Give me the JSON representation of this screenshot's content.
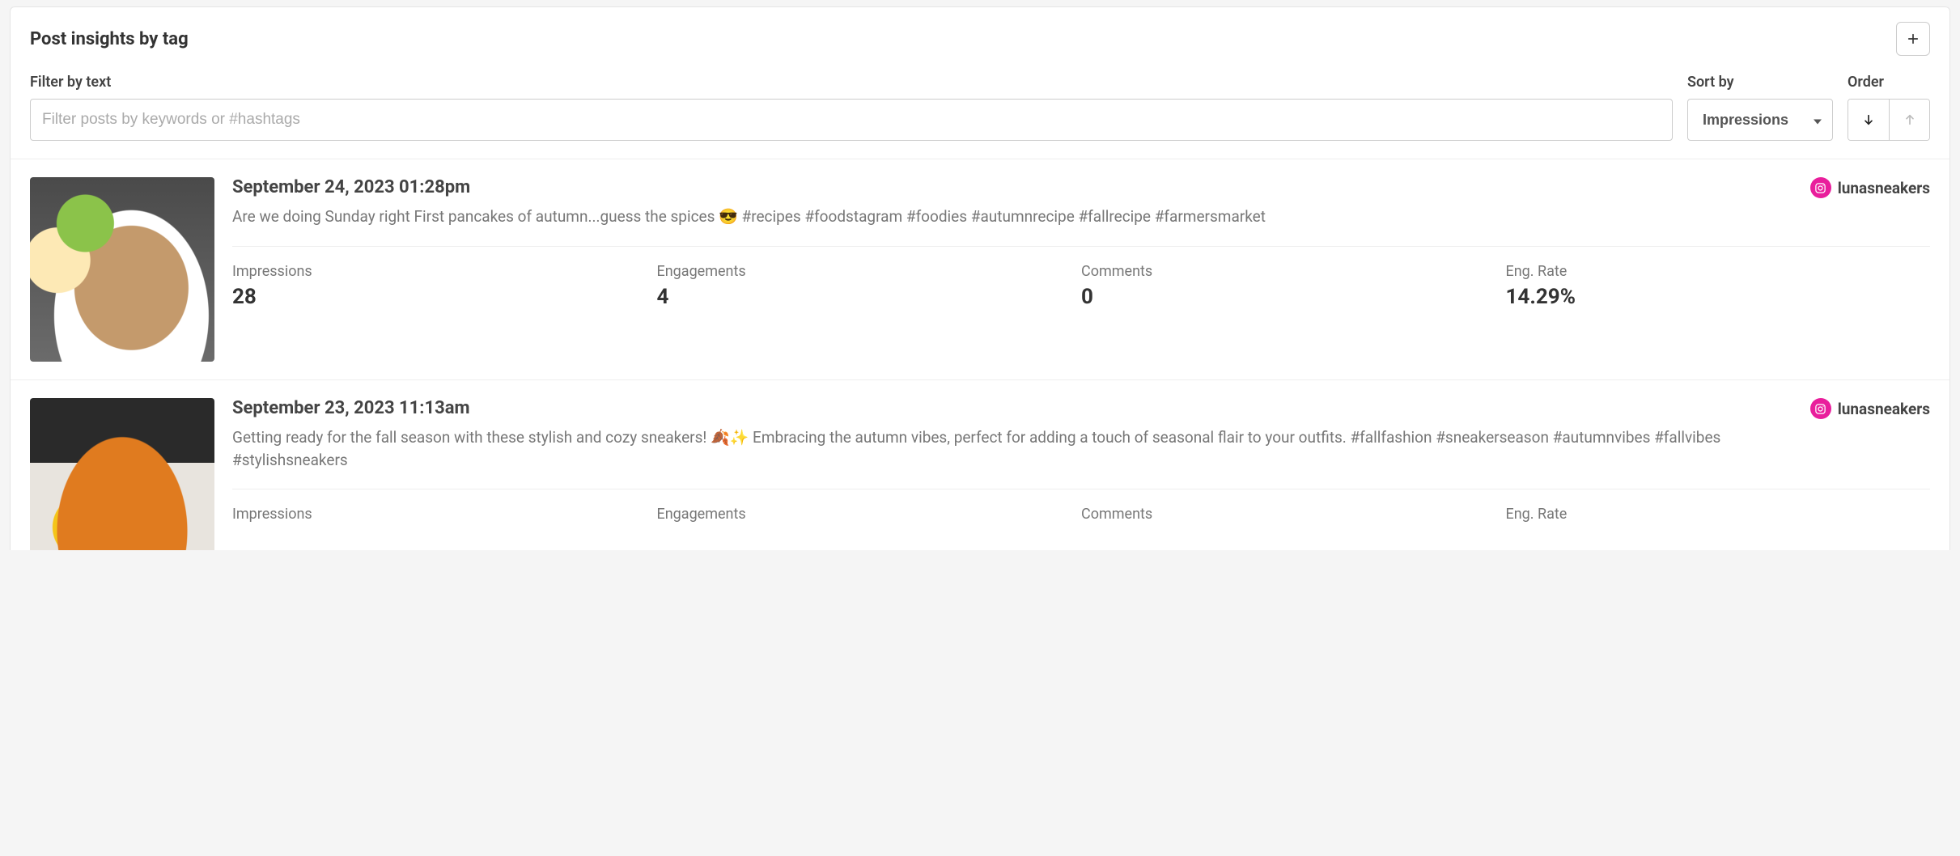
{
  "header": {
    "title": "Post insights by tag"
  },
  "controls": {
    "filter_label": "Filter by text",
    "filter_placeholder": "Filter posts by keywords or #hashtags",
    "sort_label": "Sort by",
    "sort_value": "Impressions",
    "order_label": "Order"
  },
  "metric_labels": {
    "impressions": "Impressions",
    "engagements": "Engagements",
    "comments": "Comments",
    "eng_rate": "Eng. Rate"
  },
  "posts": [
    {
      "date": "September 24, 2023 01:28pm",
      "caption": "Are we doing Sunday right First pancakes of autumn...guess the spices 😎 #recipes #foodstagram #foodies #autumnrecipe #fallrecipe #farmersmarket",
      "account": "lunasneakers",
      "metrics": {
        "impressions": "28",
        "engagements": "4",
        "comments": "0",
        "eng_rate": "14.29%"
      }
    },
    {
      "date": "September 23, 2023 11:13am",
      "caption": "Getting ready for the fall season with these stylish and cozy sneakers! 🍂✨ Embracing the autumn vibes, perfect for adding a touch of seasonal flair to your outfits. #fallfashion #sneakerseason #autumnvibes #fallvibes #stylishsneakers",
      "account": "lunasneakers",
      "metrics": {
        "impressions": "",
        "engagements": "",
        "comments": "",
        "eng_rate": ""
      }
    }
  ]
}
